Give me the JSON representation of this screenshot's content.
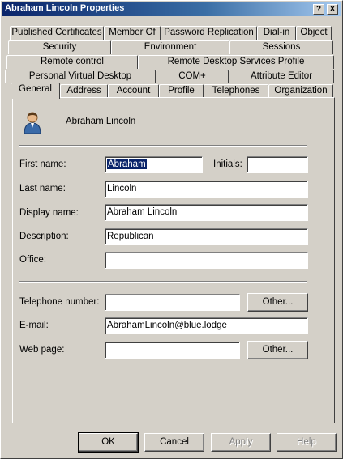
{
  "window": {
    "title": "Abraham Lincoln Properties",
    "help_btn": "?",
    "close_btn": "X"
  },
  "tabs": {
    "row1": [
      "Published Certificates",
      "Member Of",
      "Password Replication",
      "Dial-in",
      "Object"
    ],
    "row2": [
      "Security",
      "Environment",
      "Sessions"
    ],
    "row3": [
      "Remote control",
      "Remote Desktop Services Profile"
    ],
    "row4": [
      "Personal Virtual Desktop",
      "COM+",
      "Attribute Editor"
    ],
    "row5": [
      "General",
      "Address",
      "Account",
      "Profile",
      "Telephones",
      "Organization"
    ],
    "active": "General"
  },
  "general": {
    "user_name": "Abraham Lincoln",
    "first_name_label": "First name:",
    "first_name": "Abraham",
    "initials_label": "Initials:",
    "initials": "",
    "last_name_label": "Last name:",
    "last_name": "Lincoln",
    "display_name_label": "Display name:",
    "display_name": "Abraham Lincoln",
    "description_label": "Description:",
    "description": "Republican",
    "office_label": "Office:",
    "office": "",
    "telephone_label": "Telephone number:",
    "telephone": "",
    "telephone_other": "Other...",
    "email_label": "E-mail:",
    "email": "AbrahamLincoln@blue.lodge",
    "webpage_label": "Web page:",
    "webpage": "",
    "webpage_other": "Other..."
  },
  "buttons": {
    "ok": "OK",
    "cancel": "Cancel",
    "apply": "Apply",
    "help": "Help"
  }
}
